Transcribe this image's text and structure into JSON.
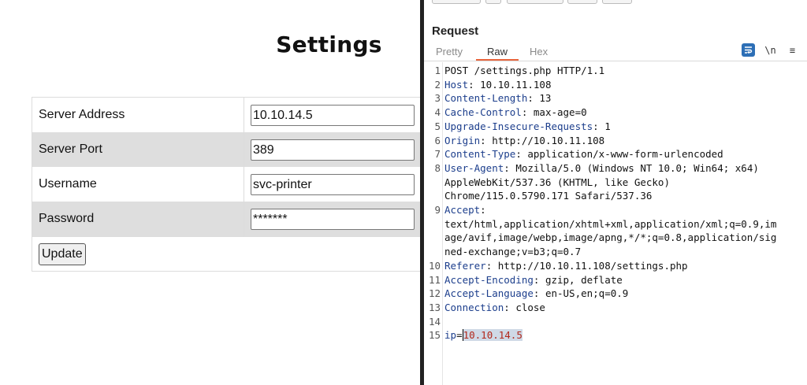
{
  "settings_page": {
    "title": "Settings",
    "rows": [
      {
        "label": "Server Address",
        "value": "10.10.14.5"
      },
      {
        "label": "Server Port",
        "value": "389"
      },
      {
        "label": "Username",
        "value": "svc-printer"
      },
      {
        "label": "Password",
        "value": "*******"
      }
    ],
    "update_button": "Update"
  },
  "request_panel": {
    "title": "Request",
    "tabs": [
      "Pretty",
      "Raw",
      "Hex"
    ],
    "active_tab": "Raw",
    "icons": [
      "wrap-lines-icon",
      "newline-icon",
      "menu-icon"
    ],
    "newline_label": "\\n",
    "menu_label": "≡",
    "lines": [
      {
        "n": "1",
        "text": "POST /settings.php HTTP/1.1"
      },
      {
        "n": "2",
        "key": "Host",
        "val": ": 10.10.11.108"
      },
      {
        "n": "3",
        "key": "Content-Length",
        "val": ": 13"
      },
      {
        "n": "4",
        "key": "Cache-Control",
        "val": ": max-age=0"
      },
      {
        "n": "5",
        "key": "Upgrade-Insecure-Requests",
        "val": ": 1"
      },
      {
        "n": "6",
        "key": "Origin",
        "val": ": http://10.10.11.108"
      },
      {
        "n": "7",
        "key": "Content-Type",
        "val": ": application/x-www-form-urlencoded"
      },
      {
        "n": "8",
        "key": "User-Agent",
        "val": ": Mozilla/5.0 (Windows NT 10.0; Win64; x64)"
      },
      {
        "n": "",
        "text": "AppleWebKit/537.36 (KHTML, like Gecko)"
      },
      {
        "n": "",
        "text": "Chrome/115.0.5790.171 Safari/537.36"
      },
      {
        "n": "9",
        "key": "Accept",
        "val": ":"
      },
      {
        "n": "",
        "text": "text/html,application/xhtml+xml,application/xml;q=0.9,im"
      },
      {
        "n": "",
        "text": "age/avif,image/webp,image/apng,*/*;q=0.8,application/sig"
      },
      {
        "n": "",
        "text": "ned-exchange;v=b3;q=0.7"
      },
      {
        "n": "10",
        "key": "Referer",
        "val": ": http://10.10.11.108/settings.php"
      },
      {
        "n": "11",
        "key": "Accept-Encoding",
        "val": ": gzip, deflate"
      },
      {
        "n": "12",
        "key": "Accept-Language",
        "val": ": en-US,en;q=0.9"
      },
      {
        "n": "13",
        "key": "Connection",
        "val": ": close"
      },
      {
        "n": "14",
        "text": ""
      },
      {
        "n": "15",
        "param": "ip",
        "eq": "=",
        "pval": "10.10.14.5"
      }
    ]
  },
  "colors": {
    "accent_tab_underline": "#e8643c",
    "header_key": "#1c3e8c",
    "param_value": "#b2281b",
    "selection": "#cfd9e6"
  }
}
